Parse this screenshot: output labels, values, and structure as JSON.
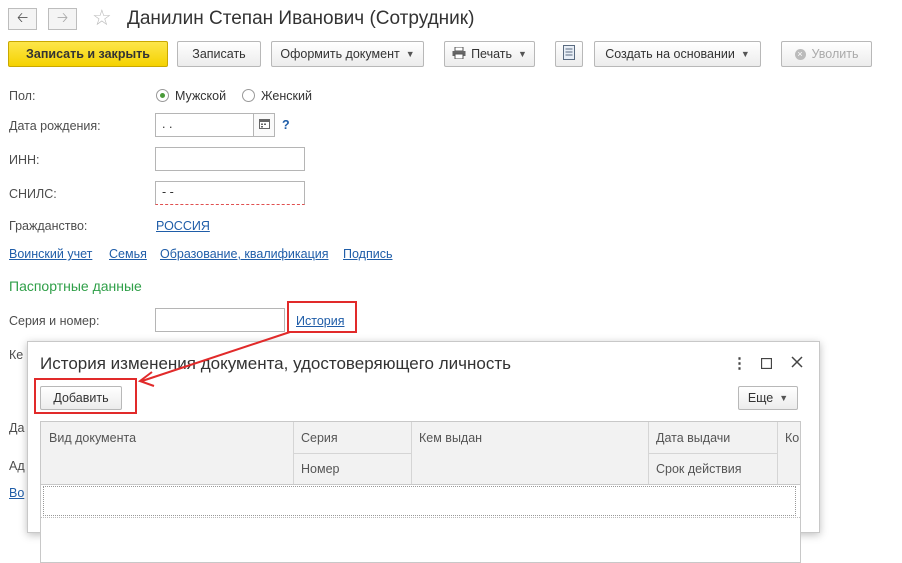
{
  "header": {
    "back_icon": "arrow-left-icon",
    "forward_icon": "arrow-right-icon",
    "favorite_icon": "star-icon",
    "title": "Данилин Степан Иванович (Сотрудник)"
  },
  "toolbar": {
    "save_close": "Записать и закрыть",
    "save": "Записать",
    "make_doc": "Оформить документ",
    "print": "Печать",
    "create_based": "Создать на основании",
    "dismiss": "Уволить"
  },
  "form": {
    "gender_label": "Пол:",
    "gender_male": "Мужской",
    "gender_female": "Женский",
    "birthdate_label": "Дата рождения:",
    "birthdate_value": " .  .",
    "help": "?",
    "inn_label": "ИНН:",
    "inn_value": "",
    "snils_label": "СНИЛС:",
    "snils_value": "   -   -",
    "citizenship_label": "Гражданство:",
    "citizenship_value": "РОССИЯ",
    "links": [
      "Воинский учет",
      "Семья",
      "Образование, квалификация",
      "Подпись"
    ],
    "passport_section": "Паспортные данные",
    "series_label": "Серия и номер:",
    "series_value": "",
    "history_link": "История",
    "cut_label_1": "Ке",
    "cut_label_2": "Да",
    "cut_label_3": "Ад",
    "cut_link": "Во"
  },
  "dialog": {
    "title": "История изменения документа, удостоверяющего личность",
    "more_icon": "more-vertical-icon",
    "maximize_icon": "maximize-icon",
    "close_icon": "close-icon",
    "add_button": "Добавить",
    "more_button": "Еще",
    "columns": {
      "doc_type": "Вид документа",
      "series": "Серия",
      "number": "Номер",
      "issued_by": "Кем выдан",
      "issue_date": "Дата выдачи",
      "valid_until": "Срок действия",
      "cut": "Ко"
    }
  }
}
